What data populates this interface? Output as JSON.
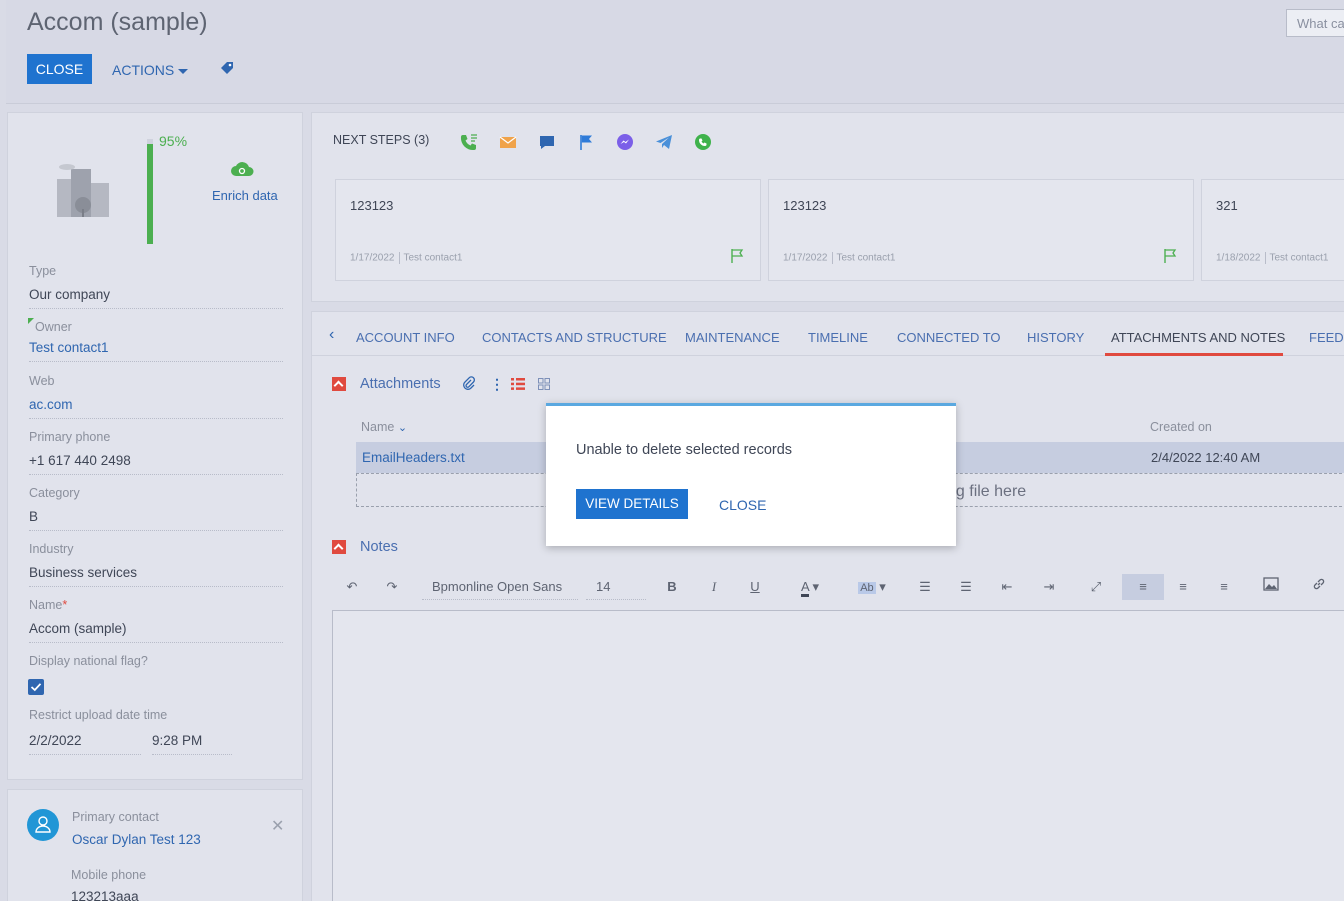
{
  "header": {
    "title": "Accom (sample)",
    "close_label": "CLOSE",
    "actions_label": "ACTIONS",
    "search_placeholder": "What ca"
  },
  "profile": {
    "completeness": "95%",
    "completeness_value": 0.95,
    "enrich_label": "Enrich data",
    "fields": {
      "type_label": "Type",
      "type_value": "Our company",
      "owner_label": "Owner",
      "owner_value": "Test contact1",
      "web_label": "Web",
      "web_value": "ac.com",
      "phone_label": "Primary phone",
      "phone_value": "+1 617 440 2498",
      "category_label": "Category",
      "category_value": "B",
      "industry_label": "Industry",
      "industry_value": "Business services",
      "name_label": "Name",
      "name_required": "*",
      "name_value": "Accom (sample)",
      "flag_label": "Display national flag?",
      "restrict_label": "Restrict upload date time",
      "restrict_date": "2/2/2022",
      "restrict_time": "9:28 PM"
    },
    "display_flag_checked": true
  },
  "contact": {
    "label": "Primary contact",
    "name": "Oscar Dylan Test 123",
    "mobile_label": "Mobile phone",
    "mobile_value": "123213aaa"
  },
  "next_steps": {
    "title": "NEXT STEPS (3)",
    "icons": [
      "phone-icon",
      "email-icon",
      "chat-icon",
      "flag-icon",
      "messenger-icon",
      "telegram-icon",
      "whatsapp-icon"
    ],
    "items": [
      {
        "text": "123123",
        "date": "1/17/2022",
        "owner": "Test contact1"
      },
      {
        "text": "123123",
        "date": "1/17/2022",
        "owner": "Test contact1"
      },
      {
        "text": "321",
        "date": "1/18/2022",
        "owner": "Test contact1"
      }
    ]
  },
  "tabs": [
    {
      "label": "ACCOUNT INFO"
    },
    {
      "label": "CONTACTS AND STRUCTURE"
    },
    {
      "label": "MAINTENANCE"
    },
    {
      "label": "TIMELINE"
    },
    {
      "label": "CONNECTED TO"
    },
    {
      "label": "HISTORY"
    },
    {
      "label": "ATTACHMENTS AND NOTES"
    },
    {
      "label": "FEED"
    }
  ],
  "attachments": {
    "title": "Attachments",
    "col_name": "Name",
    "col_created": "Created on",
    "row_name": "EmailHeaders.txt",
    "row_created": "2/4/2022 12:40 AM",
    "drop_text": "ag file here"
  },
  "notes": {
    "title": "Notes",
    "font_name": "Bpmonline Open Sans",
    "font_size": "14"
  },
  "modal": {
    "message": "Unable to delete selected records",
    "view_details_label": "VIEW DETAILS",
    "close_label": "CLOSE"
  },
  "colors": {
    "accent": "#1f73cf",
    "progress": "#4caf50",
    "tab_active": "#e04a3f"
  }
}
